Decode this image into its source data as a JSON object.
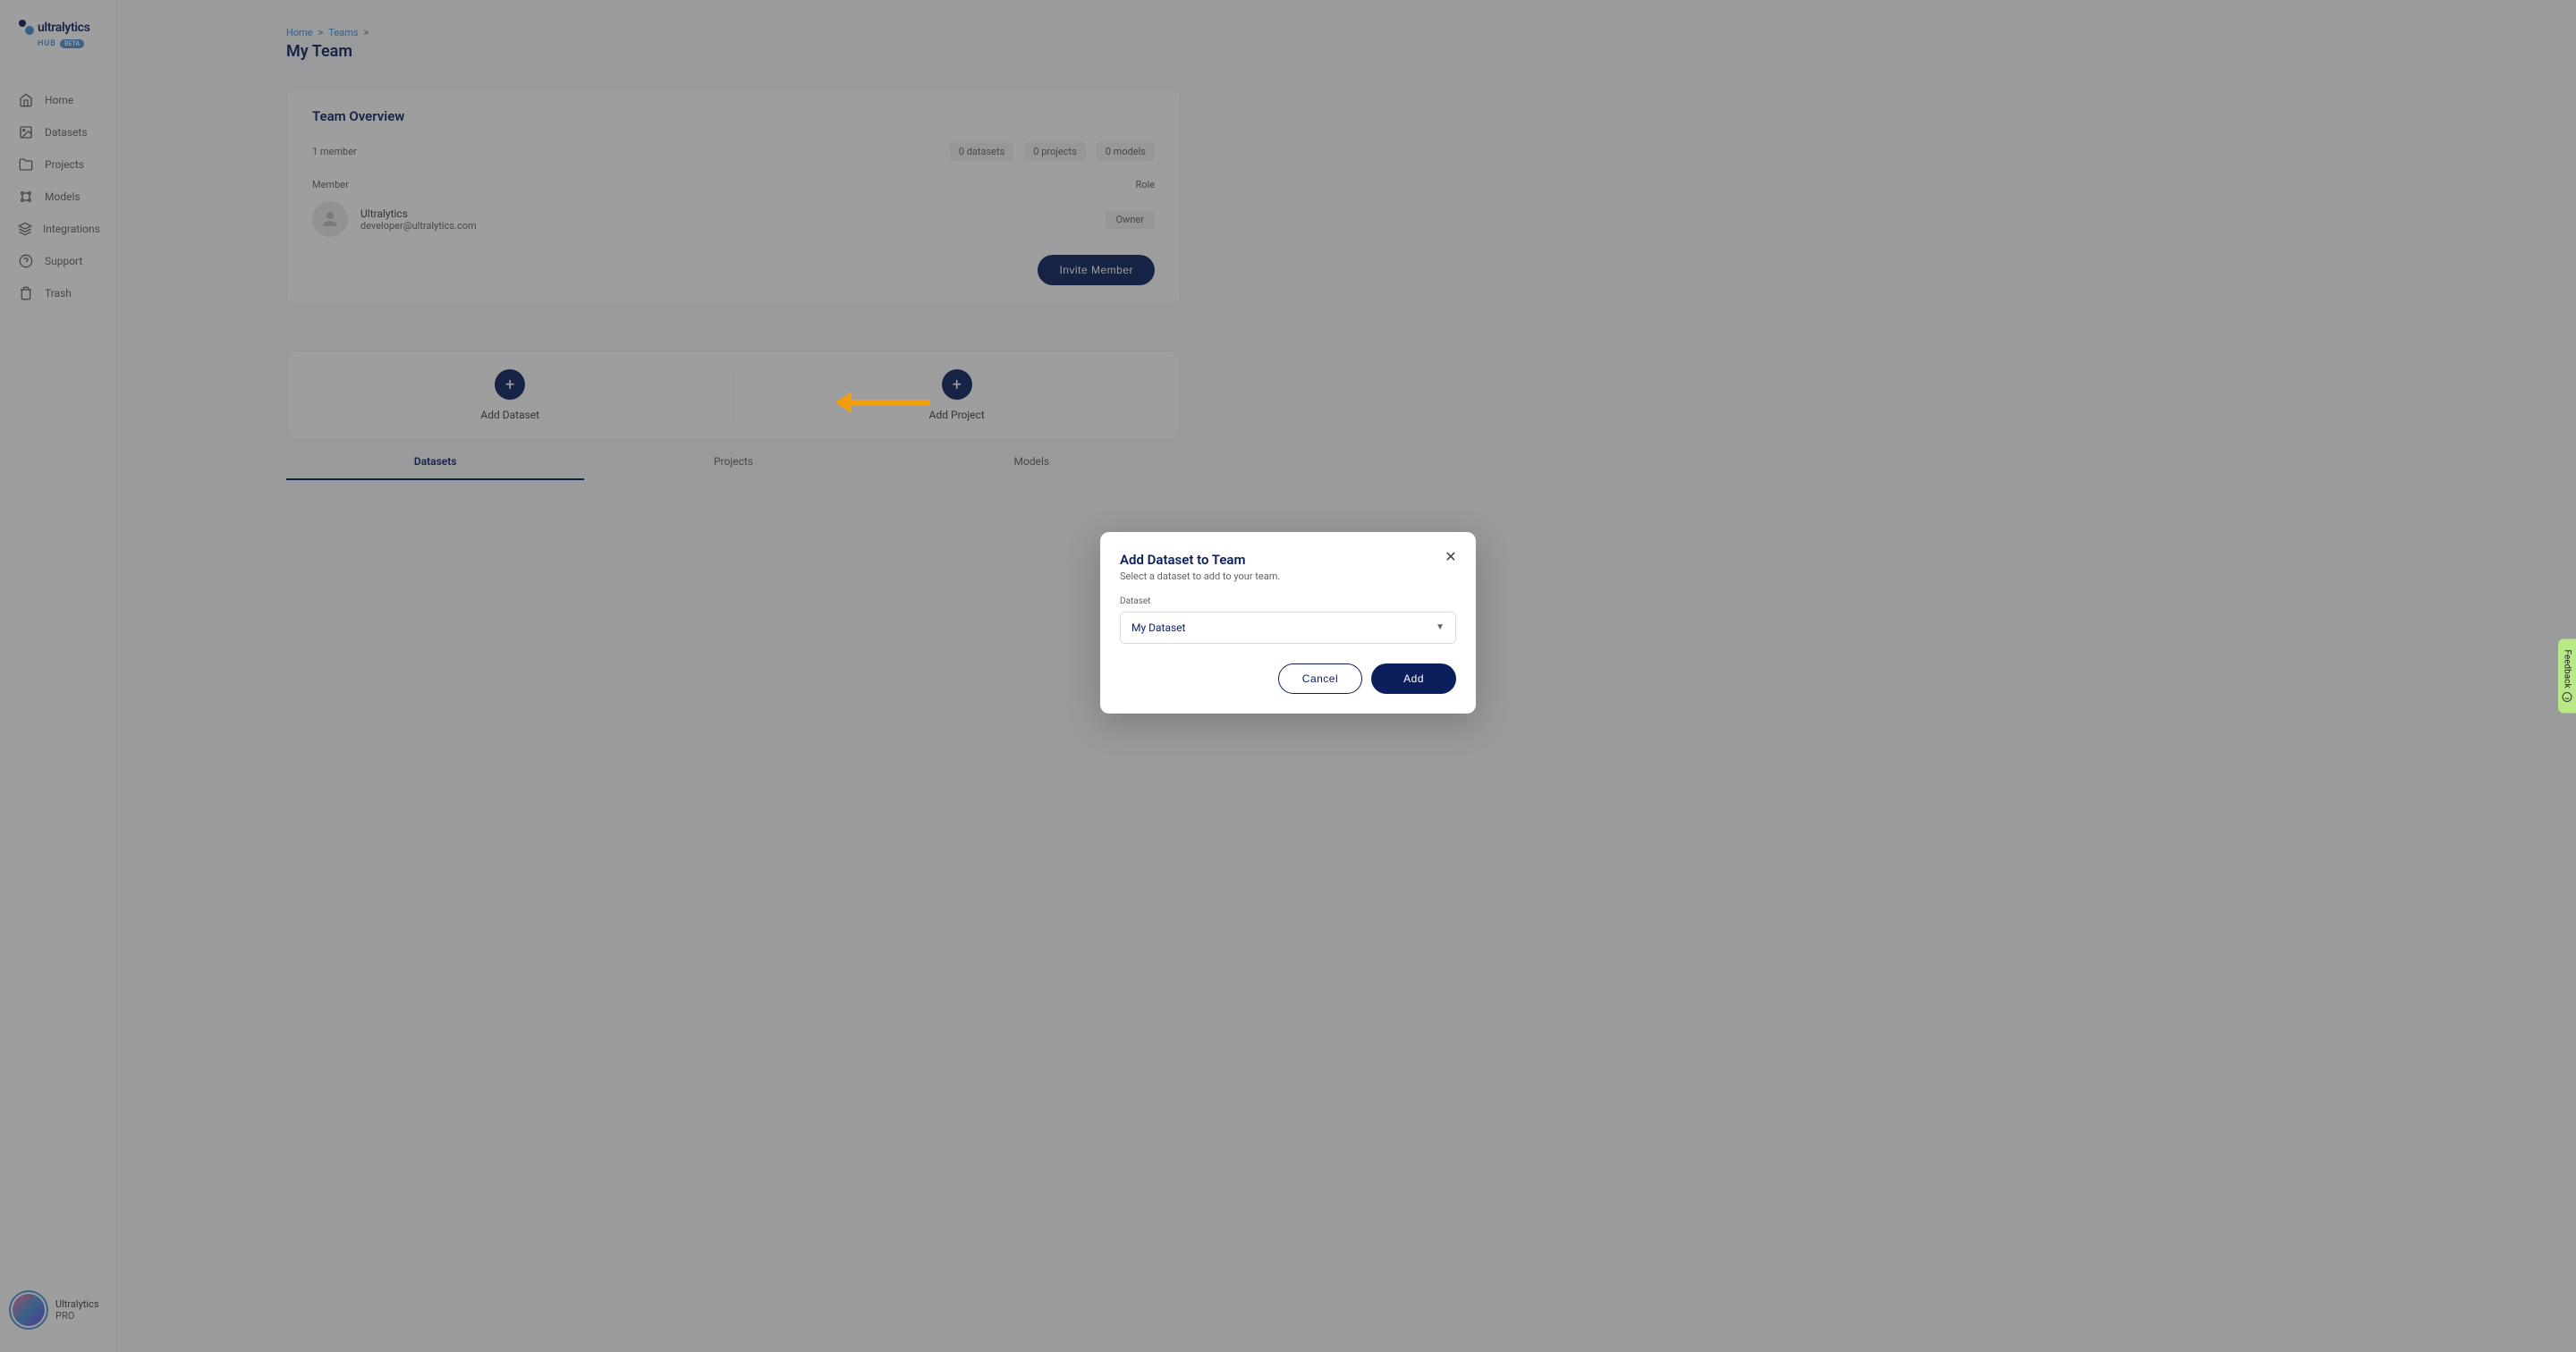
{
  "logo": {
    "text": "ultralytics",
    "hub": "HUB",
    "beta": "BETA"
  },
  "sidebar": {
    "items": [
      {
        "label": "Home"
      },
      {
        "label": "Datasets"
      },
      {
        "label": "Projects"
      },
      {
        "label": "Models"
      },
      {
        "label": "Integrations"
      },
      {
        "label": "Support"
      },
      {
        "label": "Trash"
      }
    ],
    "user": {
      "name": "Ultralytics",
      "plan": "PRO"
    }
  },
  "breadcrumb": {
    "home": "Home",
    "teams": "Teams",
    "sep": ">"
  },
  "page_title": "My Team",
  "overview": {
    "title": "Team Overview",
    "member_count": "1 member",
    "stats": {
      "datasets": "0 datasets",
      "projects": "0 projects",
      "models": "0 models"
    },
    "header_member": "Member",
    "header_role": "Role",
    "member": {
      "name": "Ultralytics",
      "email": "developer@ultralytics.com",
      "role": "Owner"
    },
    "invite_button": "Invite Member"
  },
  "add_cards": {
    "dataset": "Add Dataset",
    "project": "Add Project"
  },
  "tabs": {
    "datasets": "Datasets",
    "projects": "Projects",
    "models": "Models"
  },
  "modal": {
    "title": "Add Dataset to Team",
    "subtitle": "Select a dataset to add to your team.",
    "field_label": "Dataset",
    "selected_value": "My Dataset",
    "cancel": "Cancel",
    "add": "Add"
  },
  "feedback": "Feedback"
}
